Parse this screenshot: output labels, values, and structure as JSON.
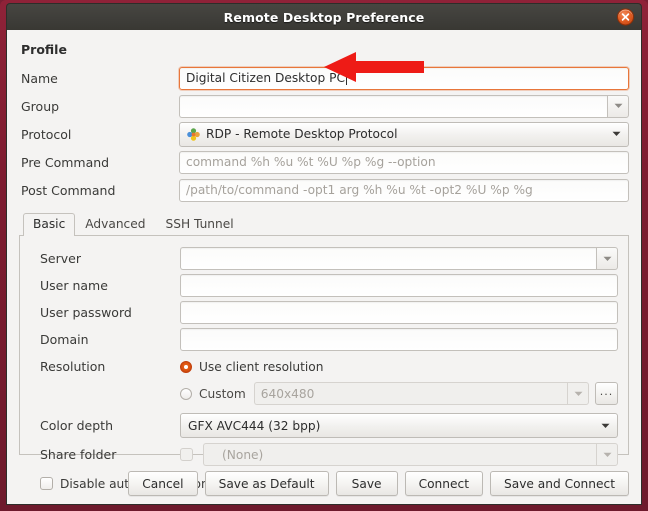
{
  "window": {
    "title": "Remote Desktop Preference",
    "close_icon": "close-icon",
    "frame_color": "#7d1c30",
    "titlebar_color": "#3f3e3a",
    "accent_color": "#e8763a"
  },
  "profile": {
    "section_label": "Profile",
    "fields": [
      {
        "label": "Name",
        "value": "Digital Citizen Desktop PC",
        "placeholder": ""
      },
      {
        "label": "Group",
        "value": "",
        "placeholder": ""
      },
      {
        "label": "Protocol",
        "value": "RDP - Remote Desktop Protocol",
        "placeholder": ""
      },
      {
        "label": "Pre Command",
        "value": "",
        "placeholder": "command %h %u %t %U %p %g --option"
      },
      {
        "label": "Post Command",
        "value": "",
        "placeholder": "/path/to/command -opt1 arg %h %u %t -opt2 %U %p %g"
      }
    ]
  },
  "tabs": [
    {
      "label": "Basic",
      "active": true
    },
    {
      "label": "Advanced",
      "active": false
    },
    {
      "label": "SSH Tunnel",
      "active": false
    }
  ],
  "basic": {
    "server": {
      "label": "Server",
      "value": ""
    },
    "user_name": {
      "label": "User name",
      "value": ""
    },
    "user_password": {
      "label": "User password",
      "value": ""
    },
    "domain": {
      "label": "Domain",
      "value": ""
    },
    "resolution": {
      "label": "Resolution",
      "use_client_label": "Use client resolution",
      "use_client_selected": true,
      "custom_label": "Custom",
      "custom_selected": false,
      "custom_value": "640x480",
      "browse_label": "..."
    },
    "color_depth": {
      "label": "Color depth",
      "value": "GFX AVC444 (32 bpp)"
    },
    "share_folder": {
      "label": "Share folder",
      "value": "(None)",
      "checked": false
    },
    "disable_reconnect": {
      "label": "Disable automatic reconnection",
      "checked": false
    }
  },
  "actions": [
    {
      "label": "Cancel"
    },
    {
      "label": "Save as Default"
    },
    {
      "label": "Save"
    },
    {
      "label": "Connect"
    },
    {
      "label": "Save and Connect"
    }
  ],
  "annotation": {
    "arrow_color": "#ee1b16",
    "arrow_direction": "left",
    "points_to": "Name"
  }
}
